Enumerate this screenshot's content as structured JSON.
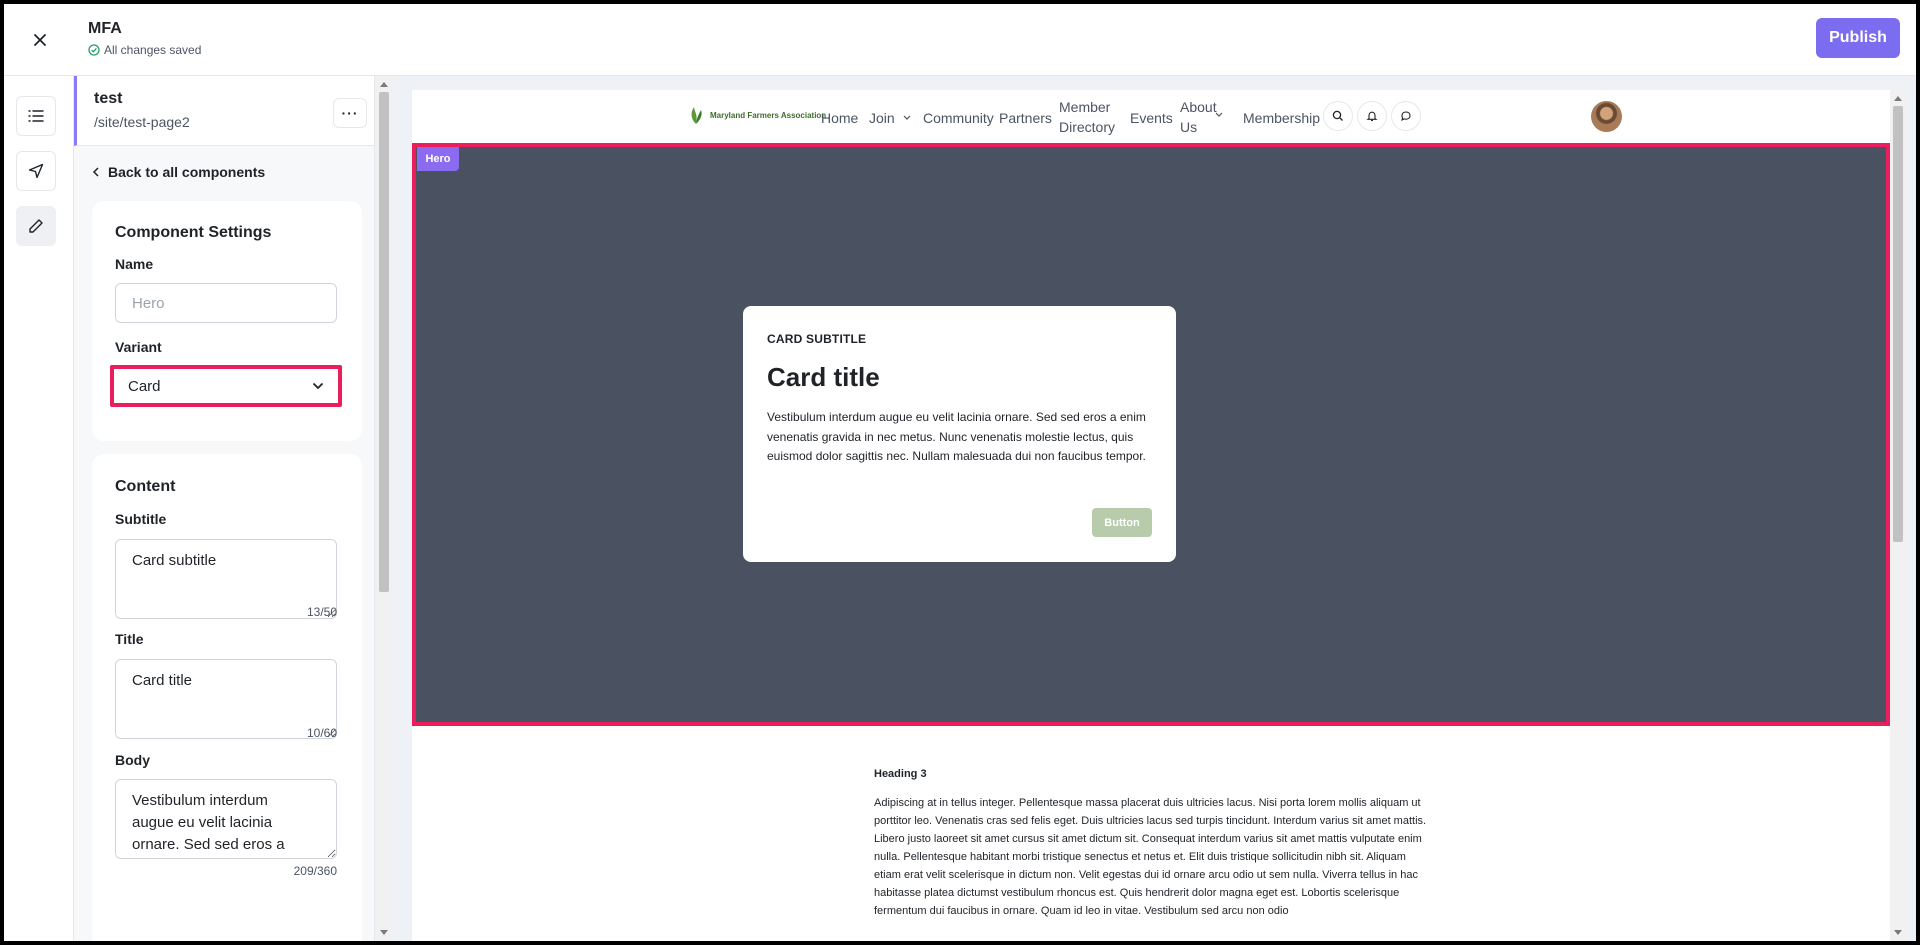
{
  "header": {
    "title": "MFA",
    "save_status": "All changes saved",
    "publish_label": "Publish"
  },
  "rail": {
    "items": [
      "list-icon",
      "send-icon",
      "pencil-icon"
    ]
  },
  "panel": {
    "page_name": "test",
    "page_path": "/site/test-page2",
    "more_label": "···",
    "back_label": "Back to all components",
    "settings": {
      "title": "Component Settings",
      "name_label": "Name",
      "name_placeholder": "Hero",
      "variant_label": "Variant",
      "variant_value": "Card"
    },
    "content": {
      "title": "Content",
      "subtitle_label": "Subtitle",
      "subtitle_value": "Card subtitle",
      "subtitle_count": "13/50",
      "title_label": "Title",
      "title_value": "Card title",
      "title_count": "10/60",
      "body_label": "Body",
      "body_value": "Vestibulum interdum augue eu velit lacinia ornare. Sed sed eros a",
      "body_count": "209/360"
    }
  },
  "site": {
    "logo_text": "Maryland Farmers Association",
    "nav": [
      "Home",
      "Join",
      "Community",
      "Partners",
      "Member Directory",
      "Events",
      "About Us",
      "Membership"
    ],
    "hero_tag": "Hero",
    "card": {
      "subtitle": "CARD SUBTITLE",
      "title": "Card title",
      "body": "Vestibulum interdum augue eu velit lacinia ornare. Sed sed eros a enim venenatis gravida in nec metus. Nunc venenatis molestie lectus, quis euismod dolor sagittis nec. Nullam malesuada dui non faucibus tempor.",
      "button": "Button"
    },
    "section": {
      "heading": "Heading 3",
      "body": "Adipiscing at in tellus integer. Pellentesque massa placerat duis ultricies lacus. Nisi porta lorem mollis aliquam ut porttitor leo. Venenatis cras sed felis eget. Duis ultricies lacus sed turpis tincidunt. Interdum varius sit amet mattis. Libero justo laoreet sit amet cursus sit amet dictum sit. Consequat interdum varius sit amet mattis vulputate enim nulla. Pellentesque habitant morbi tristique senectus et netus et. Elit duis tristique sollicitudin nibh sit. Aliquam etiam erat velit scelerisque in dictum non. Velit egestas dui id ornare arcu odio ut sem nulla. Viverra tellus in hac habitasse platea dictumst vestibulum rhoncus est. Quis hendrerit dolor magna eget est. Lobortis scelerisque fermentum dui faucibus in ornare. Quam id leo in vitae. Vestibulum sed arcu non odio"
    }
  },
  "colors": {
    "accent": "#7c6cf0",
    "highlight": "#ea1d5d",
    "hero_bg": "#4a5160",
    "card_button": "#b8cbab"
  }
}
